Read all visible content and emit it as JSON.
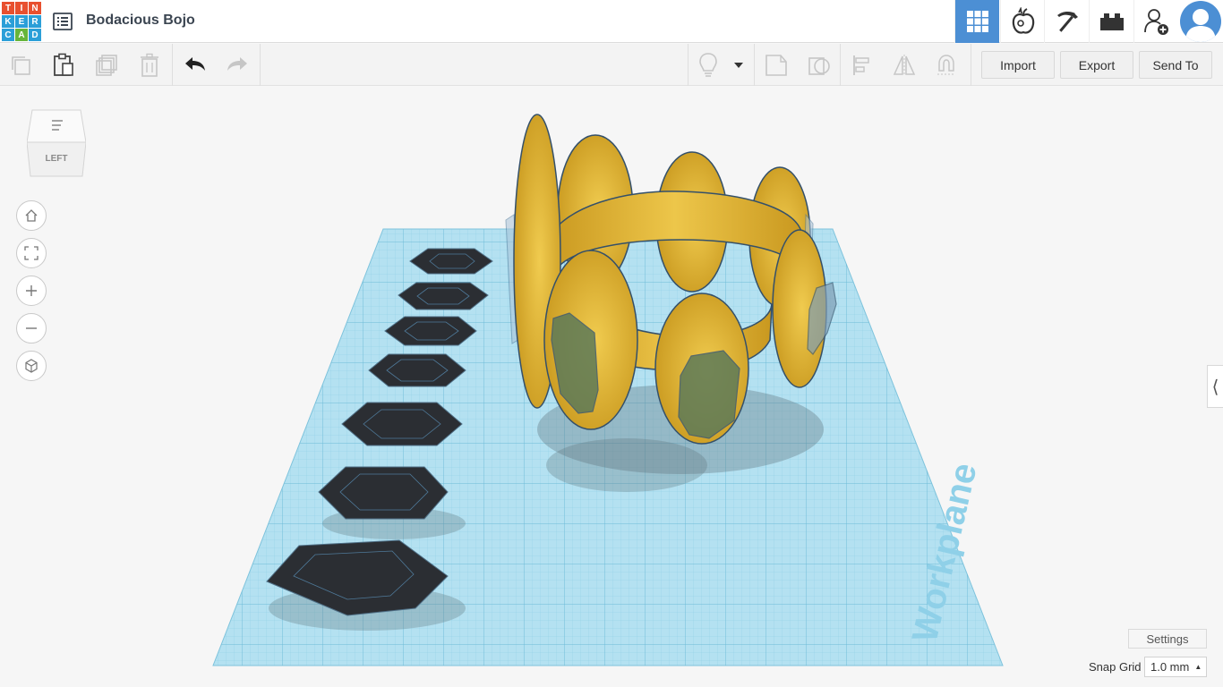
{
  "app": {
    "logo_letters": [
      "T",
      "I",
      "N",
      "K",
      "E",
      "R",
      "C",
      "A",
      "D"
    ],
    "project_title": "Bodacious Bojo"
  },
  "top_views": [
    {
      "name": "3d-design-view",
      "icon": "grid-icon",
      "active": true
    },
    {
      "name": "sim-lab-view",
      "icon": "apple-icon",
      "active": false
    },
    {
      "name": "blocks-view",
      "icon": "pickaxe-icon",
      "active": false
    },
    {
      "name": "bricks-view",
      "icon": "brick-icon",
      "active": false
    }
  ],
  "toolbar": {
    "import_label": "Import",
    "export_label": "Export",
    "send_to_label": "Send To"
  },
  "view_cube": {
    "face_label": "LEFT"
  },
  "workplane": {
    "label": "Workplane"
  },
  "footer": {
    "settings_label": "Settings",
    "snap_grid_label": "Snap Grid",
    "snap_grid_value": "1.0 mm"
  },
  "colors": {
    "accent": "#4c8fd4",
    "workplane": "#a8dcee",
    "gold": "#e0b52e",
    "dark_shape": "#2b2e33"
  }
}
